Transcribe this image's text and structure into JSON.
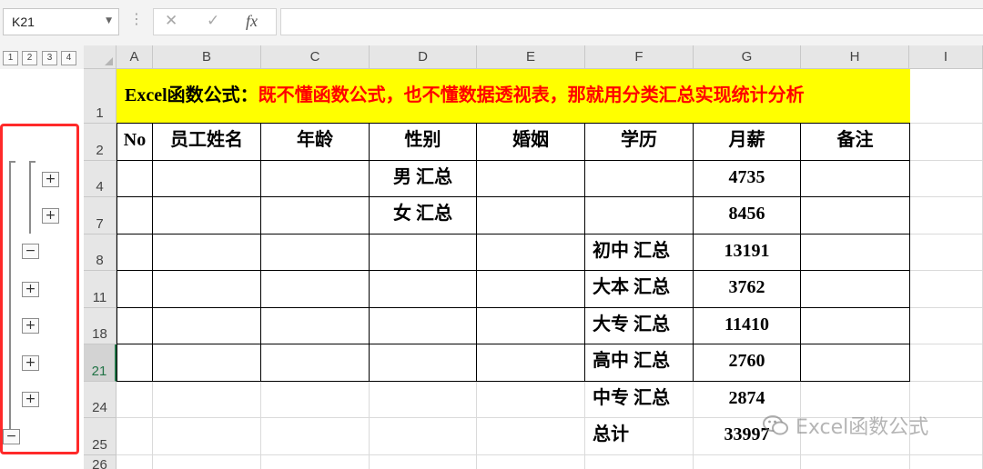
{
  "formula_bar": {
    "name_box": "K21",
    "cancel_icon": "✕",
    "enter_icon": "✓",
    "function_icon": "fx",
    "formula_value": ""
  },
  "outline_levels": [
    "1",
    "2",
    "3",
    "4"
  ],
  "columns": [
    "A",
    "B",
    "C",
    "D",
    "E",
    "F",
    "G",
    "H",
    "I"
  ],
  "rows": [
    "1",
    "2",
    "4",
    "7",
    "8",
    "11",
    "18",
    "21",
    "24",
    "25",
    "26"
  ],
  "active_cell": "K21",
  "title": {
    "black": "Excel函数公式：",
    "red": "既不懂函数公式，也不懂数据透视表，那就用分类汇总实现统计分析"
  },
  "table": {
    "headers": [
      "No",
      "员工姓名",
      "年龄",
      "性别",
      "婚姻",
      "学历",
      "月薪",
      "备注"
    ],
    "rows": [
      {
        "no": "",
        "name": "",
        "age": "",
        "gender": "男 汇总",
        "marriage": "",
        "education": "",
        "salary": "4735",
        "note": ""
      },
      {
        "no": "",
        "name": "",
        "age": "",
        "gender": "女 汇总",
        "marriage": "",
        "education": "",
        "salary": "8456",
        "note": ""
      },
      {
        "no": "",
        "name": "",
        "age": "",
        "gender": "",
        "marriage": "",
        "education": "初中 汇总",
        "salary": "13191",
        "note": ""
      },
      {
        "no": "",
        "name": "",
        "age": "",
        "gender": "",
        "marriage": "",
        "education": "大本 汇总",
        "salary": "3762",
        "note": ""
      },
      {
        "no": "",
        "name": "",
        "age": "",
        "gender": "",
        "marriage": "",
        "education": "大专 汇总",
        "salary": "11410",
        "note": ""
      },
      {
        "no": "",
        "name": "",
        "age": "",
        "gender": "",
        "marriage": "",
        "education": "高中 汇总",
        "salary": "2760",
        "note": ""
      },
      {
        "no": "",
        "name": "",
        "age": "",
        "gender": "",
        "marriage": "",
        "education": "中专 汇总",
        "salary": "2874",
        "note": ""
      },
      {
        "no": "",
        "name": "",
        "age": "",
        "gender": "",
        "marriage": "",
        "education": "总计",
        "salary": "33997",
        "note": ""
      }
    ]
  },
  "outline_symbols": {
    "expand": "+",
    "collapse": "−"
  },
  "watermark": "Excel函数公式",
  "colors": {
    "title_background": "#ffff00",
    "title_red": "#ff0000",
    "highlight_frame": "#ff2a2a",
    "active_row_text": "#217346"
  }
}
